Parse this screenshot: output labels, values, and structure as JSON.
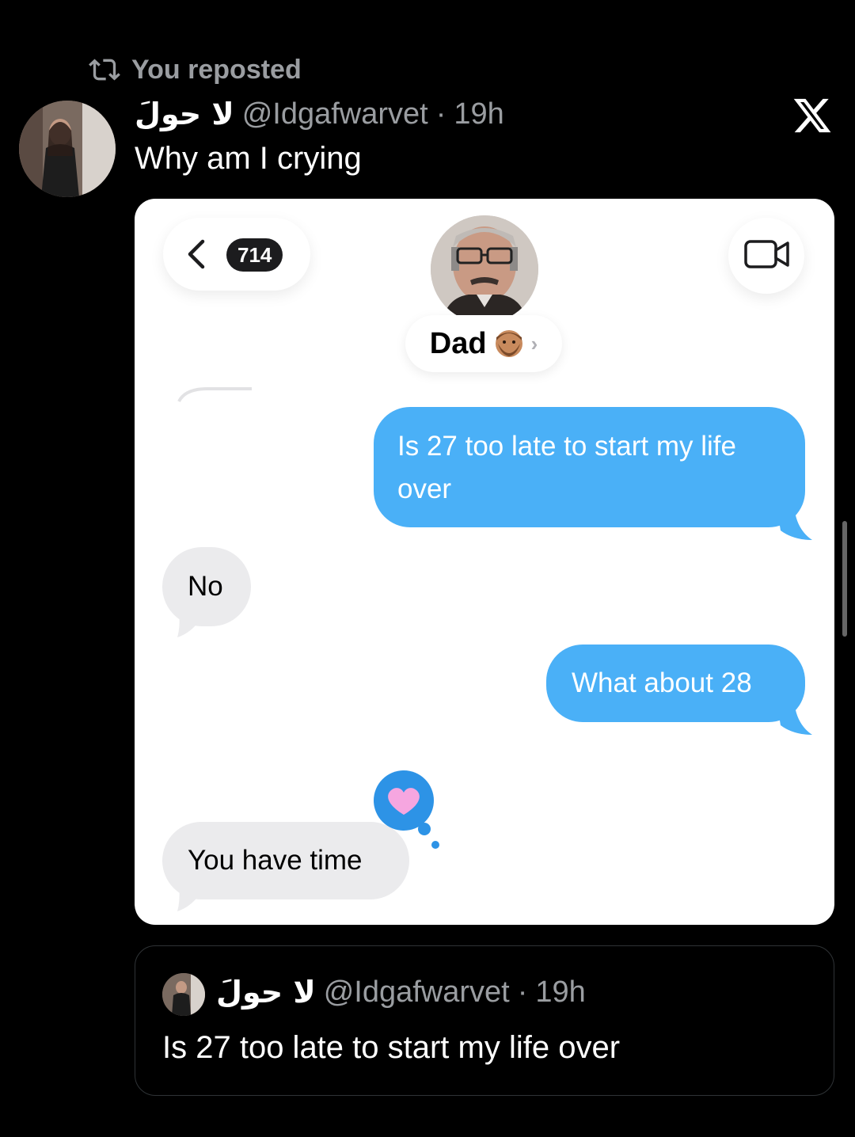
{
  "repost": {
    "label": "You reposted"
  },
  "tweet": {
    "display_name": "لا حولَ",
    "handle": "@Idgafwarvet",
    "separator": "·",
    "time": "19h",
    "text": "Why am I crying"
  },
  "screenshot": {
    "unread_count": "714",
    "contact_name": "Dad",
    "contact_chevron": "›",
    "messages": [
      {
        "direction": "sent",
        "text": "Is 27 too late to start my life over"
      },
      {
        "direction": "received",
        "text": "No"
      },
      {
        "direction": "sent",
        "text": "What about 28"
      },
      {
        "direction": "received",
        "text": "You have time",
        "reaction": "heart"
      }
    ]
  },
  "quoted_tweet": {
    "display_name": "لا حولَ",
    "handle": "@Idgafwarvet",
    "separator": "·",
    "time": "19h",
    "text": "Is 27 too late to start my life over"
  },
  "colors": {
    "sent_bubble": "#4ab0f7",
    "received_bubble": "#ebebed",
    "background": "#000000"
  }
}
